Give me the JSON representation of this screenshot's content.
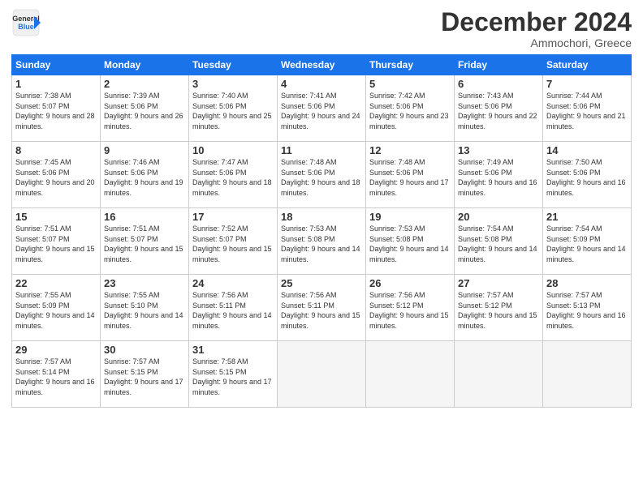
{
  "header": {
    "logo_line1": "General",
    "logo_line2": "Blue",
    "month_year": "December 2024",
    "location": "Ammochori, Greece"
  },
  "days_of_week": [
    "Sunday",
    "Monday",
    "Tuesday",
    "Wednesday",
    "Thursday",
    "Friday",
    "Saturday"
  ],
  "weeks": [
    [
      {
        "num": "1",
        "sunrise": "7:38 AM",
        "sunset": "5:07 PM",
        "daylight": "9 hours and 28 minutes."
      },
      {
        "num": "2",
        "sunrise": "7:39 AM",
        "sunset": "5:06 PM",
        "daylight": "9 hours and 26 minutes."
      },
      {
        "num": "3",
        "sunrise": "7:40 AM",
        "sunset": "5:06 PM",
        "daylight": "9 hours and 25 minutes."
      },
      {
        "num": "4",
        "sunrise": "7:41 AM",
        "sunset": "5:06 PM",
        "daylight": "9 hours and 24 minutes."
      },
      {
        "num": "5",
        "sunrise": "7:42 AM",
        "sunset": "5:06 PM",
        "daylight": "9 hours and 23 minutes."
      },
      {
        "num": "6",
        "sunrise": "7:43 AM",
        "sunset": "5:06 PM",
        "daylight": "9 hours and 22 minutes."
      },
      {
        "num": "7",
        "sunrise": "7:44 AM",
        "sunset": "5:06 PM",
        "daylight": "9 hours and 21 minutes."
      }
    ],
    [
      {
        "num": "8",
        "sunrise": "7:45 AM",
        "sunset": "5:06 PM",
        "daylight": "9 hours and 20 minutes."
      },
      {
        "num": "9",
        "sunrise": "7:46 AM",
        "sunset": "5:06 PM",
        "daylight": "9 hours and 19 minutes."
      },
      {
        "num": "10",
        "sunrise": "7:47 AM",
        "sunset": "5:06 PM",
        "daylight": "9 hours and 18 minutes."
      },
      {
        "num": "11",
        "sunrise": "7:48 AM",
        "sunset": "5:06 PM",
        "daylight": "9 hours and 18 minutes."
      },
      {
        "num": "12",
        "sunrise": "7:48 AM",
        "sunset": "5:06 PM",
        "daylight": "9 hours and 17 minutes."
      },
      {
        "num": "13",
        "sunrise": "7:49 AM",
        "sunset": "5:06 PM",
        "daylight": "9 hours and 16 minutes."
      },
      {
        "num": "14",
        "sunrise": "7:50 AM",
        "sunset": "5:06 PM",
        "daylight": "9 hours and 16 minutes."
      }
    ],
    [
      {
        "num": "15",
        "sunrise": "7:51 AM",
        "sunset": "5:07 PM",
        "daylight": "9 hours and 15 minutes."
      },
      {
        "num": "16",
        "sunrise": "7:51 AM",
        "sunset": "5:07 PM",
        "daylight": "9 hours and 15 minutes."
      },
      {
        "num": "17",
        "sunrise": "7:52 AM",
        "sunset": "5:07 PM",
        "daylight": "9 hours and 15 minutes."
      },
      {
        "num": "18",
        "sunrise": "7:53 AM",
        "sunset": "5:08 PM",
        "daylight": "9 hours and 14 minutes."
      },
      {
        "num": "19",
        "sunrise": "7:53 AM",
        "sunset": "5:08 PM",
        "daylight": "9 hours and 14 minutes."
      },
      {
        "num": "20",
        "sunrise": "7:54 AM",
        "sunset": "5:08 PM",
        "daylight": "9 hours and 14 minutes."
      },
      {
        "num": "21",
        "sunrise": "7:54 AM",
        "sunset": "5:09 PM",
        "daylight": "9 hours and 14 minutes."
      }
    ],
    [
      {
        "num": "22",
        "sunrise": "7:55 AM",
        "sunset": "5:09 PM",
        "daylight": "9 hours and 14 minutes."
      },
      {
        "num": "23",
        "sunrise": "7:55 AM",
        "sunset": "5:10 PM",
        "daylight": "9 hours and 14 minutes."
      },
      {
        "num": "24",
        "sunrise": "7:56 AM",
        "sunset": "5:11 PM",
        "daylight": "9 hours and 14 minutes."
      },
      {
        "num": "25",
        "sunrise": "7:56 AM",
        "sunset": "5:11 PM",
        "daylight": "9 hours and 15 minutes."
      },
      {
        "num": "26",
        "sunrise": "7:56 AM",
        "sunset": "5:12 PM",
        "daylight": "9 hours and 15 minutes."
      },
      {
        "num": "27",
        "sunrise": "7:57 AM",
        "sunset": "5:12 PM",
        "daylight": "9 hours and 15 minutes."
      },
      {
        "num": "28",
        "sunrise": "7:57 AM",
        "sunset": "5:13 PM",
        "daylight": "9 hours and 16 minutes."
      }
    ],
    [
      {
        "num": "29",
        "sunrise": "7:57 AM",
        "sunset": "5:14 PM",
        "daylight": "9 hours and 16 minutes."
      },
      {
        "num": "30",
        "sunrise": "7:57 AM",
        "sunset": "5:15 PM",
        "daylight": "9 hours and 17 minutes."
      },
      {
        "num": "31",
        "sunrise": "7:58 AM",
        "sunset": "5:15 PM",
        "daylight": "9 hours and 17 minutes."
      },
      null,
      null,
      null,
      null
    ]
  ]
}
